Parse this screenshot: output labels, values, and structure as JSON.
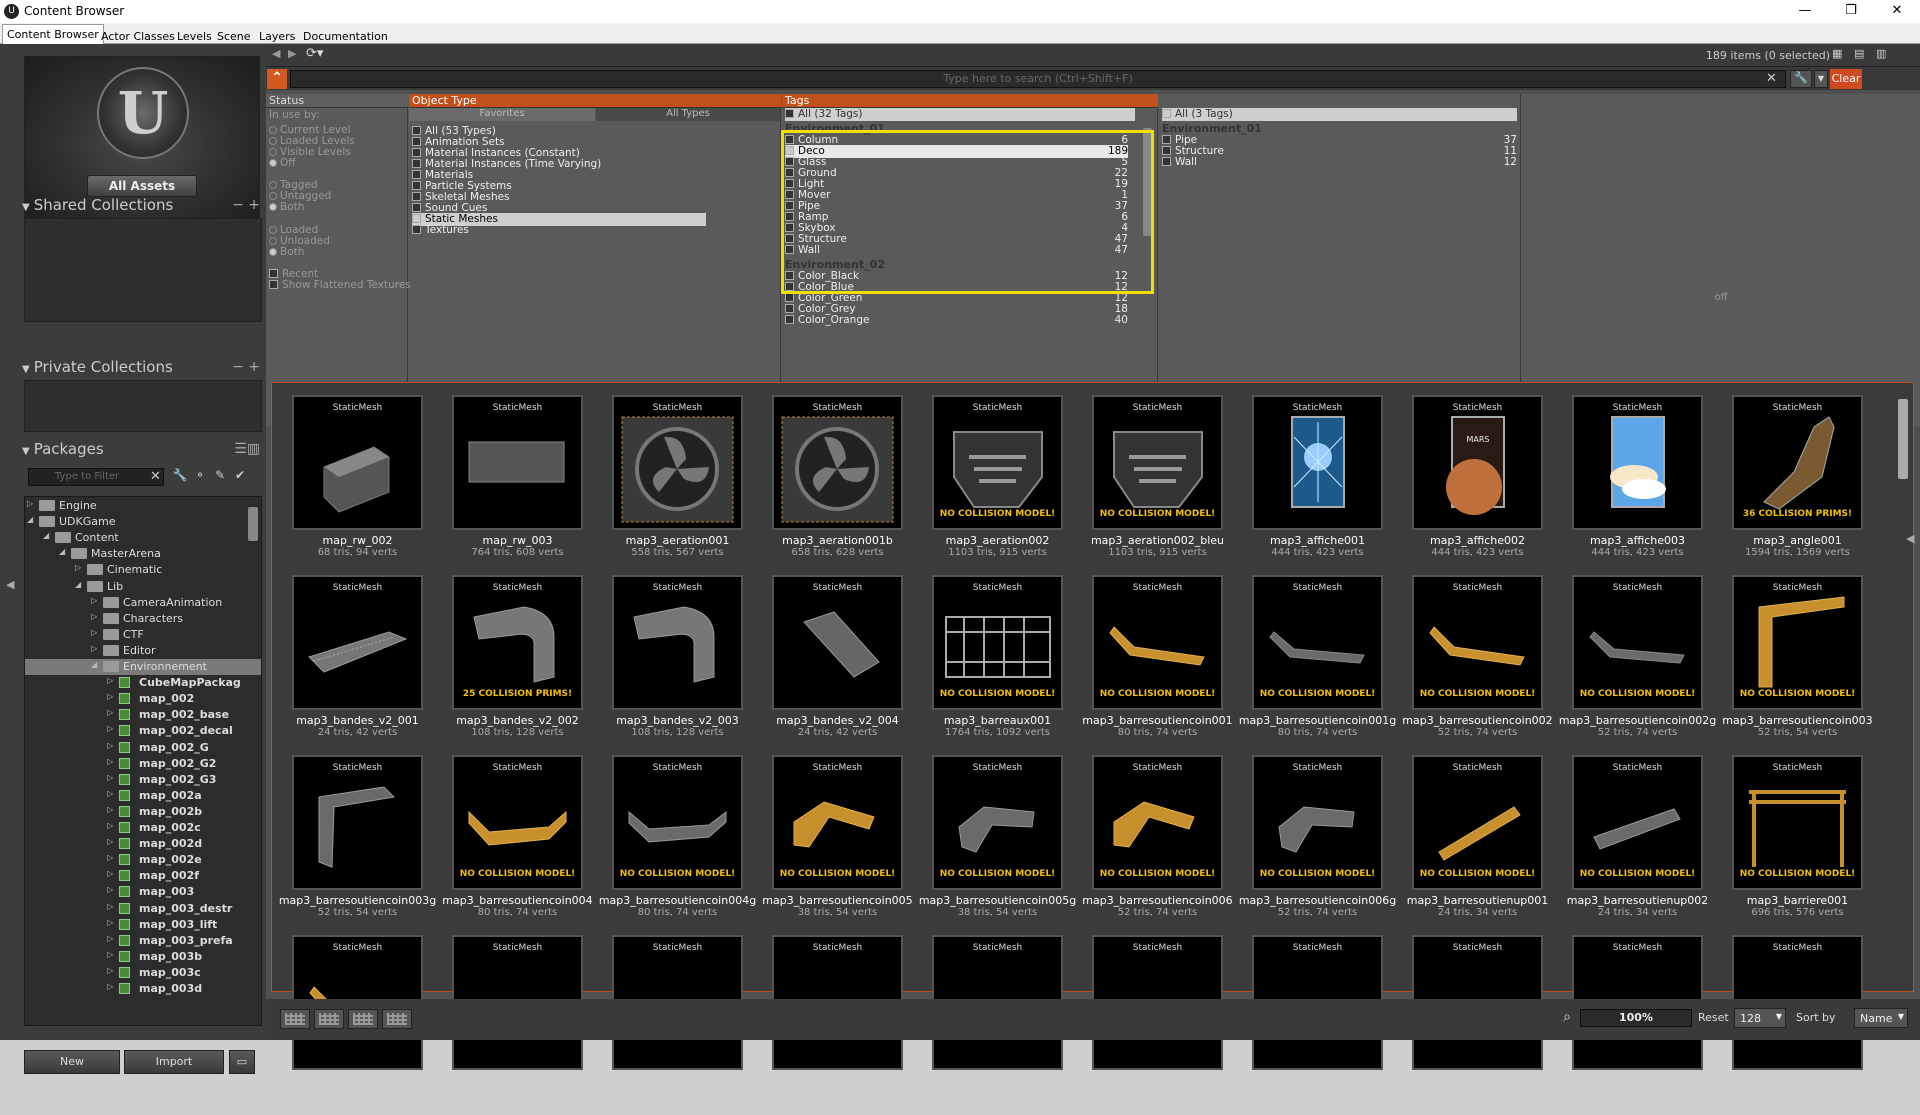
{
  "window": {
    "title": "Content Browser",
    "app_icon": "U",
    "controls": [
      "—",
      "❐",
      "✕"
    ]
  },
  "tabs": [
    "Content Browser",
    "Actor Classes",
    "Levels",
    "Scene",
    "Layers",
    "Documentation"
  ],
  "left": {
    "all_assets": "All Assets",
    "shared_collections": "Shared Collections",
    "private_collections": "Private Collections",
    "packages": "Packages",
    "pkg_filter_placeholder": "Type to Filter",
    "tree": [
      {
        "label": "Engine",
        "depth": 0,
        "exp": "▷",
        "icon": "folder"
      },
      {
        "label": "UDKGame",
        "depth": 0,
        "exp": "◢",
        "icon": "folder"
      },
      {
        "label": "Content",
        "depth": 1,
        "exp": "◢",
        "icon": "folder"
      },
      {
        "label": "MasterArena",
        "depth": 2,
        "exp": "◢",
        "icon": "folder"
      },
      {
        "label": "Cinematic",
        "depth": 3,
        "exp": "▷",
        "icon": "folder"
      },
      {
        "label": "Lib",
        "depth": 3,
        "exp": "◢",
        "icon": "folder"
      },
      {
        "label": "CameraAnimation",
        "depth": 4,
        "exp": "▷",
        "icon": "folder"
      },
      {
        "label": "Characters",
        "depth": 4,
        "exp": "▷",
        "icon": "folder"
      },
      {
        "label": "CTF",
        "depth": 4,
        "exp": "▷",
        "icon": "folder"
      },
      {
        "label": "Editor",
        "depth": 4,
        "exp": "▷",
        "icon": "folder"
      },
      {
        "label": "Environnement",
        "depth": 4,
        "exp": "◢",
        "icon": "folder",
        "sel": true
      },
      {
        "label": "CubeMapPackag",
        "depth": 5,
        "exp": "▷",
        "icon": "pkg"
      },
      {
        "label": "map_002",
        "depth": 5,
        "exp": "▷",
        "icon": "pkg"
      },
      {
        "label": "map_002_base",
        "depth": 5,
        "exp": "▷",
        "icon": "pkg"
      },
      {
        "label": "map_002_decal",
        "depth": 5,
        "exp": "▷",
        "icon": "pkg"
      },
      {
        "label": "map_002_G",
        "depth": 5,
        "exp": "▷",
        "icon": "pkg"
      },
      {
        "label": "map_002_G2",
        "depth": 5,
        "exp": "▷",
        "icon": "pkg"
      },
      {
        "label": "map_002_G3",
        "depth": 5,
        "exp": "▷",
        "icon": "pkg"
      },
      {
        "label": "map_002a",
        "depth": 5,
        "exp": "▷",
        "icon": "pkg"
      },
      {
        "label": "map_002b",
        "depth": 5,
        "exp": "▷",
        "icon": "pkg"
      },
      {
        "label": "map_002c",
        "depth": 5,
        "exp": "▷",
        "icon": "pkg"
      },
      {
        "label": "map_002d",
        "depth": 5,
        "exp": "▷",
        "icon": "pkg"
      },
      {
        "label": "map_002e",
        "depth": 5,
        "exp": "▷",
        "icon": "pkg"
      },
      {
        "label": "map_002f",
        "depth": 5,
        "exp": "▷",
        "icon": "pkg"
      },
      {
        "label": "map_003",
        "depth": 5,
        "exp": "▷",
        "icon": "pkg"
      },
      {
        "label": "map_003_destr",
        "depth": 5,
        "exp": "▷",
        "icon": "pkg"
      },
      {
        "label": "map_003_lift",
        "depth": 5,
        "exp": "▷",
        "icon": "pkg"
      },
      {
        "label": "map_003_prefa",
        "depth": 5,
        "exp": "▷",
        "icon": "pkg"
      },
      {
        "label": "map_003b",
        "depth": 5,
        "exp": "▷",
        "icon": "pkg"
      },
      {
        "label": "map_003c",
        "depth": 5,
        "exp": "▷",
        "icon": "pkg"
      },
      {
        "label": "map_003d",
        "depth": 5,
        "exp": "▷",
        "icon": "pkg"
      }
    ],
    "new_btn": "New",
    "import_btn": "Import"
  },
  "main": {
    "item_count": "189 items (0 selected)",
    "search_placeholder": "Type here to search  (Ctrl+Shift+F)",
    "clear": "Clear",
    "status": {
      "header": "Status",
      "in_use_by": "In use by:",
      "rows": [
        {
          "label": "Current Level",
          "type": "radio",
          "on": false
        },
        {
          "label": "Loaded Levels",
          "type": "radio",
          "on": false
        },
        {
          "label": "Visible Levels",
          "type": "radio",
          "on": false
        },
        {
          "label": "Off",
          "type": "radio",
          "on": true
        },
        {
          "label": "Tagged",
          "type": "radio",
          "on": false
        },
        {
          "label": "Untagged",
          "type": "radio",
          "on": false
        },
        {
          "label": "Both",
          "type": "radio",
          "on": true
        },
        {
          "label": "Loaded",
          "type": "radio",
          "on": false
        },
        {
          "label": "Unloaded",
          "type": "radio",
          "on": false
        },
        {
          "label": "Both",
          "type": "radio",
          "on": true
        },
        {
          "label": "Recent",
          "type": "check",
          "on": false
        },
        {
          "label": "Show Flattened Textures",
          "type": "check",
          "on": false
        }
      ]
    },
    "object_type": {
      "header": "Object Type",
      "favorites": "Favorites",
      "all_types": "All Types",
      "rows": [
        {
          "label": "All (53 Types)",
          "on": false
        },
        {
          "label": "Animation Sets",
          "on": false
        },
        {
          "label": "Material Instances (Constant)",
          "on": false
        },
        {
          "label": "Material Instances (Time Varying)",
          "on": false
        },
        {
          "label": "Materials",
          "on": false
        },
        {
          "label": "Particle Systems",
          "on": false
        },
        {
          "label": "Skeletal Meshes",
          "on": false
        },
        {
          "label": "Sound Cues",
          "on": false
        },
        {
          "label": "Static Meshes",
          "on": true
        },
        {
          "label": "Textures",
          "on": false
        }
      ]
    },
    "tags": {
      "header": "Tags",
      "all": "All (32 Tags)",
      "group1": "Environment_01",
      "rows1": [
        {
          "label": "Column",
          "count": "6"
        },
        {
          "label": "Deco",
          "count": "189",
          "on": true
        },
        {
          "label": "Glass",
          "count": "5"
        },
        {
          "label": "Ground",
          "count": "22"
        },
        {
          "label": "Light",
          "count": "19"
        },
        {
          "label": "Mover",
          "count": "1"
        },
        {
          "label": "Pipe",
          "count": "37"
        },
        {
          "label": "Ramp",
          "count": "6"
        },
        {
          "label": "Skybox",
          "count": "4"
        },
        {
          "label": "Structure",
          "count": "47"
        },
        {
          "label": "Wall",
          "count": "47"
        }
      ],
      "group2": "Environment_02",
      "rows2": [
        {
          "label": "Color_Black",
          "count": "12"
        },
        {
          "label": "Color_Blue",
          "count": "12"
        },
        {
          "label": "Color_Green",
          "count": "12"
        },
        {
          "label": "Color_Grey",
          "count": "18"
        },
        {
          "label": "Color_Orange",
          "count": "40"
        }
      ]
    },
    "tags2": {
      "all": "All (3 Tags)",
      "group": "Environment_01",
      "rows": [
        {
          "label": "Pipe",
          "count": "37"
        },
        {
          "label": "Structure",
          "count": "11"
        },
        {
          "label": "Wall",
          "count": "12"
        }
      ]
    },
    "off_label": "off",
    "asset_type": "StaticMesh",
    "assets": [
      {
        "name": "map_rw_002",
        "stats": "68 tris, 94 verts",
        "warn": "",
        "shape": "block"
      },
      {
        "name": "map_rw_003",
        "stats": "764 tris, 608 verts",
        "warn": "",
        "shape": "panel"
      },
      {
        "name": "map3_aeration001",
        "stats": "558 tris, 567 verts",
        "warn": "",
        "shape": "fan"
      },
      {
        "name": "map3_aeration001b",
        "stats": "658 tris, 628 verts",
        "warn": "",
        "shape": "fan"
      },
      {
        "name": "map3_aeration002",
        "stats": "1103 tris, 915 verts",
        "warn": "NO COLLISION MODEL!",
        "shape": "vent"
      },
      {
        "name": "map3_aeration002_bleu",
        "stats": "1103 tris, 915 verts",
        "warn": "NO COLLISION MODEL!",
        "shape": "vent"
      },
      {
        "name": "map3_affiche001",
        "stats": "444 tris, 423 verts",
        "warn": "",
        "shape": "poster-blue"
      },
      {
        "name": "map3_affiche002",
        "stats": "444 tris, 423 verts",
        "warn": "",
        "shape": "poster-mars"
      },
      {
        "name": "map3_affiche003",
        "stats": "444 tris, 423 verts",
        "warn": "",
        "shape": "poster-sky"
      },
      {
        "name": "map3_angle001",
        "stats": "1594 tris, 1569 verts",
        "warn": "36 COLLISION PRIMS!",
        "shape": "angle"
      },
      {
        "name": "map3_bandes_v2_001",
        "stats": "24 tris, 42 verts",
        "warn": "",
        "shape": "band"
      },
      {
        "name": "map3_bandes_v2_002",
        "stats": "108 tris, 128 verts",
        "warn": "25 COLLISION PRIMS!",
        "shape": "corner"
      },
      {
        "name": "map3_bandes_v2_003",
        "stats": "108 tris, 128 verts",
        "warn": "",
        "shape": "corner"
      },
      {
        "name": "map3_bandes_v2_004",
        "stats": "24 tris, 42 verts",
        "warn": "",
        "shape": "slab"
      },
      {
        "name": "map3_barreaux001",
        "stats": "1764 tris, 1092 verts",
        "warn": "NO COLLISION MODEL!",
        "shape": "bars"
      },
      {
        "name": "map3_barresoutiencoin001",
        "stats": "80 tris, 74 verts",
        "warn": "NO COLLISION MODEL!",
        "shape": "rail-o"
      },
      {
        "name": "map3_barresoutiencoin001g",
        "stats": "80 tris, 74 verts",
        "warn": "NO COLLISION MODEL!",
        "shape": "rail-g"
      },
      {
        "name": "map3_barresoutiencoin002",
        "stats": "52 tris, 74 verts",
        "warn": "NO COLLISION MODEL!",
        "shape": "rail-o"
      },
      {
        "name": "map3_barresoutiencoin002g",
        "stats": "52 tris, 74 verts",
        "warn": "NO COLLISION MODEL!",
        "shape": "rail-g"
      },
      {
        "name": "map3_barresoutiencoin003",
        "stats": "52 tris, 54 verts",
        "warn": "NO COLLISION MODEL!",
        "shape": "l-o"
      },
      {
        "name": "map3_barresoutiencoin003g",
        "stats": "52 tris, 54 verts",
        "warn": "",
        "shape": "l-g"
      },
      {
        "name": "map3_barresoutiencoin004",
        "stats": "80 tris, 74 verts",
        "warn": "NO COLLISION MODEL!",
        "shape": "bar-o"
      },
      {
        "name": "map3_barresoutiencoin004g",
        "stats": "80 tris, 74 verts",
        "warn": "NO COLLISION MODEL!",
        "shape": "bar-g"
      },
      {
        "name": "map3_barresoutiencoin005",
        "stats": "38 tris, 54 verts",
        "warn": "NO COLLISION MODEL!",
        "shape": "elbow-o"
      },
      {
        "name": "map3_barresoutiencoin005g",
        "stats": "38 tris, 54 verts",
        "warn": "NO COLLISION MODEL!",
        "shape": "elbow-g"
      },
      {
        "name": "map3_barresoutiencoin006",
        "stats": "52 tris, 74 verts",
        "warn": "NO COLLISION MODEL!",
        "shape": "elbow-o"
      },
      {
        "name": "map3_barresoutiencoin006g",
        "stats": "52 tris, 74 verts",
        "warn": "NO COLLISION MODEL!",
        "shape": "elbow-g"
      },
      {
        "name": "map3_barresoutienup001",
        "stats": "24 tris, 34 verts",
        "warn": "NO COLLISION MODEL!",
        "shape": "stick-o"
      },
      {
        "name": "map3_barresoutienup002",
        "stats": "24 tris, 34 verts",
        "warn": "NO COLLISION MODEL!",
        "shape": "stick-g"
      },
      {
        "name": "map3_barriere001",
        "stats": "696 tris, 576 verts",
        "warn": "NO COLLISION MODEL!",
        "shape": "frame"
      },
      {
        "name": "",
        "stats": "",
        "warn": "",
        "shape": "rail-o"
      },
      {
        "name": "",
        "stats": "",
        "warn": "",
        "shape": "none"
      },
      {
        "name": "",
        "stats": "",
        "warn": "",
        "shape": "none"
      },
      {
        "name": "",
        "stats": "",
        "warn": "",
        "shape": "none"
      },
      {
        "name": "",
        "stats": "",
        "warn": "",
        "shape": "none"
      },
      {
        "name": "",
        "stats": "",
        "warn": "",
        "shape": "none"
      },
      {
        "name": "",
        "stats": "",
        "warn": "",
        "shape": "none"
      },
      {
        "name": "",
        "stats": "",
        "warn": "",
        "shape": "none"
      },
      {
        "name": "",
        "stats": "",
        "warn": "",
        "shape": "none"
      },
      {
        "name": "",
        "stats": "",
        "warn": "",
        "shape": "none"
      }
    ],
    "zoom": "100%",
    "reset": "Reset",
    "thumb_size": "128",
    "sort_by": "Sort by",
    "sort_value": "Name"
  },
  "colors": {
    "accent": "#c0501c",
    "highlight": "#f0e000",
    "warning": "#f0c000",
    "orange_mesh": "#c8902c"
  }
}
